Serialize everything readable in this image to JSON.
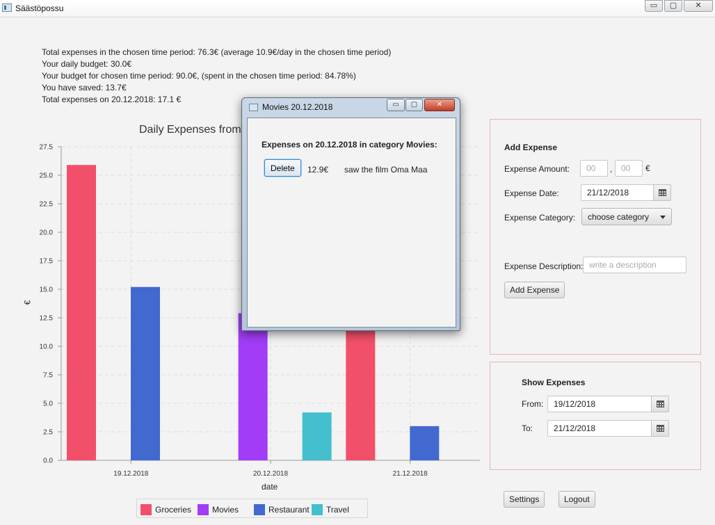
{
  "window": {
    "title": "Säästöpossu",
    "minimize": "▭",
    "maximize": "▢",
    "close": "✕"
  },
  "summary": [
    "Total expenses in the chosen time period: 76.3€ (average 10.9€/day in the chosen time period)",
    "Your daily budget: 30.0€",
    "Your budget for chosen time period: 90.0€, (spent in the chosen time period: 84.78%)",
    "You have saved: 13.7€",
    "Total expenses on 20.12.2018: 17.1 €"
  ],
  "chart_title_visible": "Daily Expenses from",
  "chart_data": {
    "type": "bar",
    "title": "Daily Expenses from",
    "xlabel": "date",
    "ylabel": "€",
    "ylim": [
      0,
      27.5
    ],
    "yticks": [
      "0.0",
      "2.5",
      "5.0",
      "7.5",
      "10.0",
      "12.5",
      "15.0",
      "17.5",
      "20.0",
      "22.5",
      "25.0",
      "27.5"
    ],
    "categories": [
      "19.12.2018",
      "20.12.2018",
      "21.12.2018"
    ],
    "series": [
      {
        "name": "Groceries",
        "color": "#f2506a",
        "values": [
          25.9,
          0,
          11.7
        ]
      },
      {
        "name": "Movies",
        "color": "#a23cf6",
        "values": [
          0,
          12.9,
          0
        ]
      },
      {
        "name": "Restaurant",
        "color": "#4269d0",
        "values": [
          15.2,
          0,
          3.0
        ]
      },
      {
        "name": "Travel",
        "color": "#44bfce",
        "values": [
          0,
          4.2,
          0
        ]
      }
    ],
    "grid": true,
    "legend": "bottom"
  },
  "add_expense": {
    "title": "Add Expense",
    "amount_label": "Expense Amount:",
    "amount_euros_placeholder": "00",
    "amount_separator": ",",
    "amount_cents_placeholder": "00",
    "currency": "€",
    "date_label": "Expense Date:",
    "date_value": "21/12/2018",
    "category_label": "Expense Category:",
    "category_value": "choose category",
    "description_label": "Expense Description:",
    "description_placeholder": "write a description",
    "submit_label": "Add Expense"
  },
  "show_expenses": {
    "title": "Show Expenses",
    "from_label": "From:",
    "from_value": "19/12/2018",
    "to_label": "To:",
    "to_value": "21/12/2018"
  },
  "footer": {
    "settings_label": "Settings",
    "logout_label": "Logout"
  },
  "dialog": {
    "title": "Movies 20.12.2018",
    "heading": "Expenses on 20.12.2018 in category Movies:",
    "delete_label": "Delete",
    "amount": "12.9€",
    "description": "saw the film Oma Maa",
    "minimize": "▭",
    "maximize": "▢",
    "close": "✕"
  }
}
